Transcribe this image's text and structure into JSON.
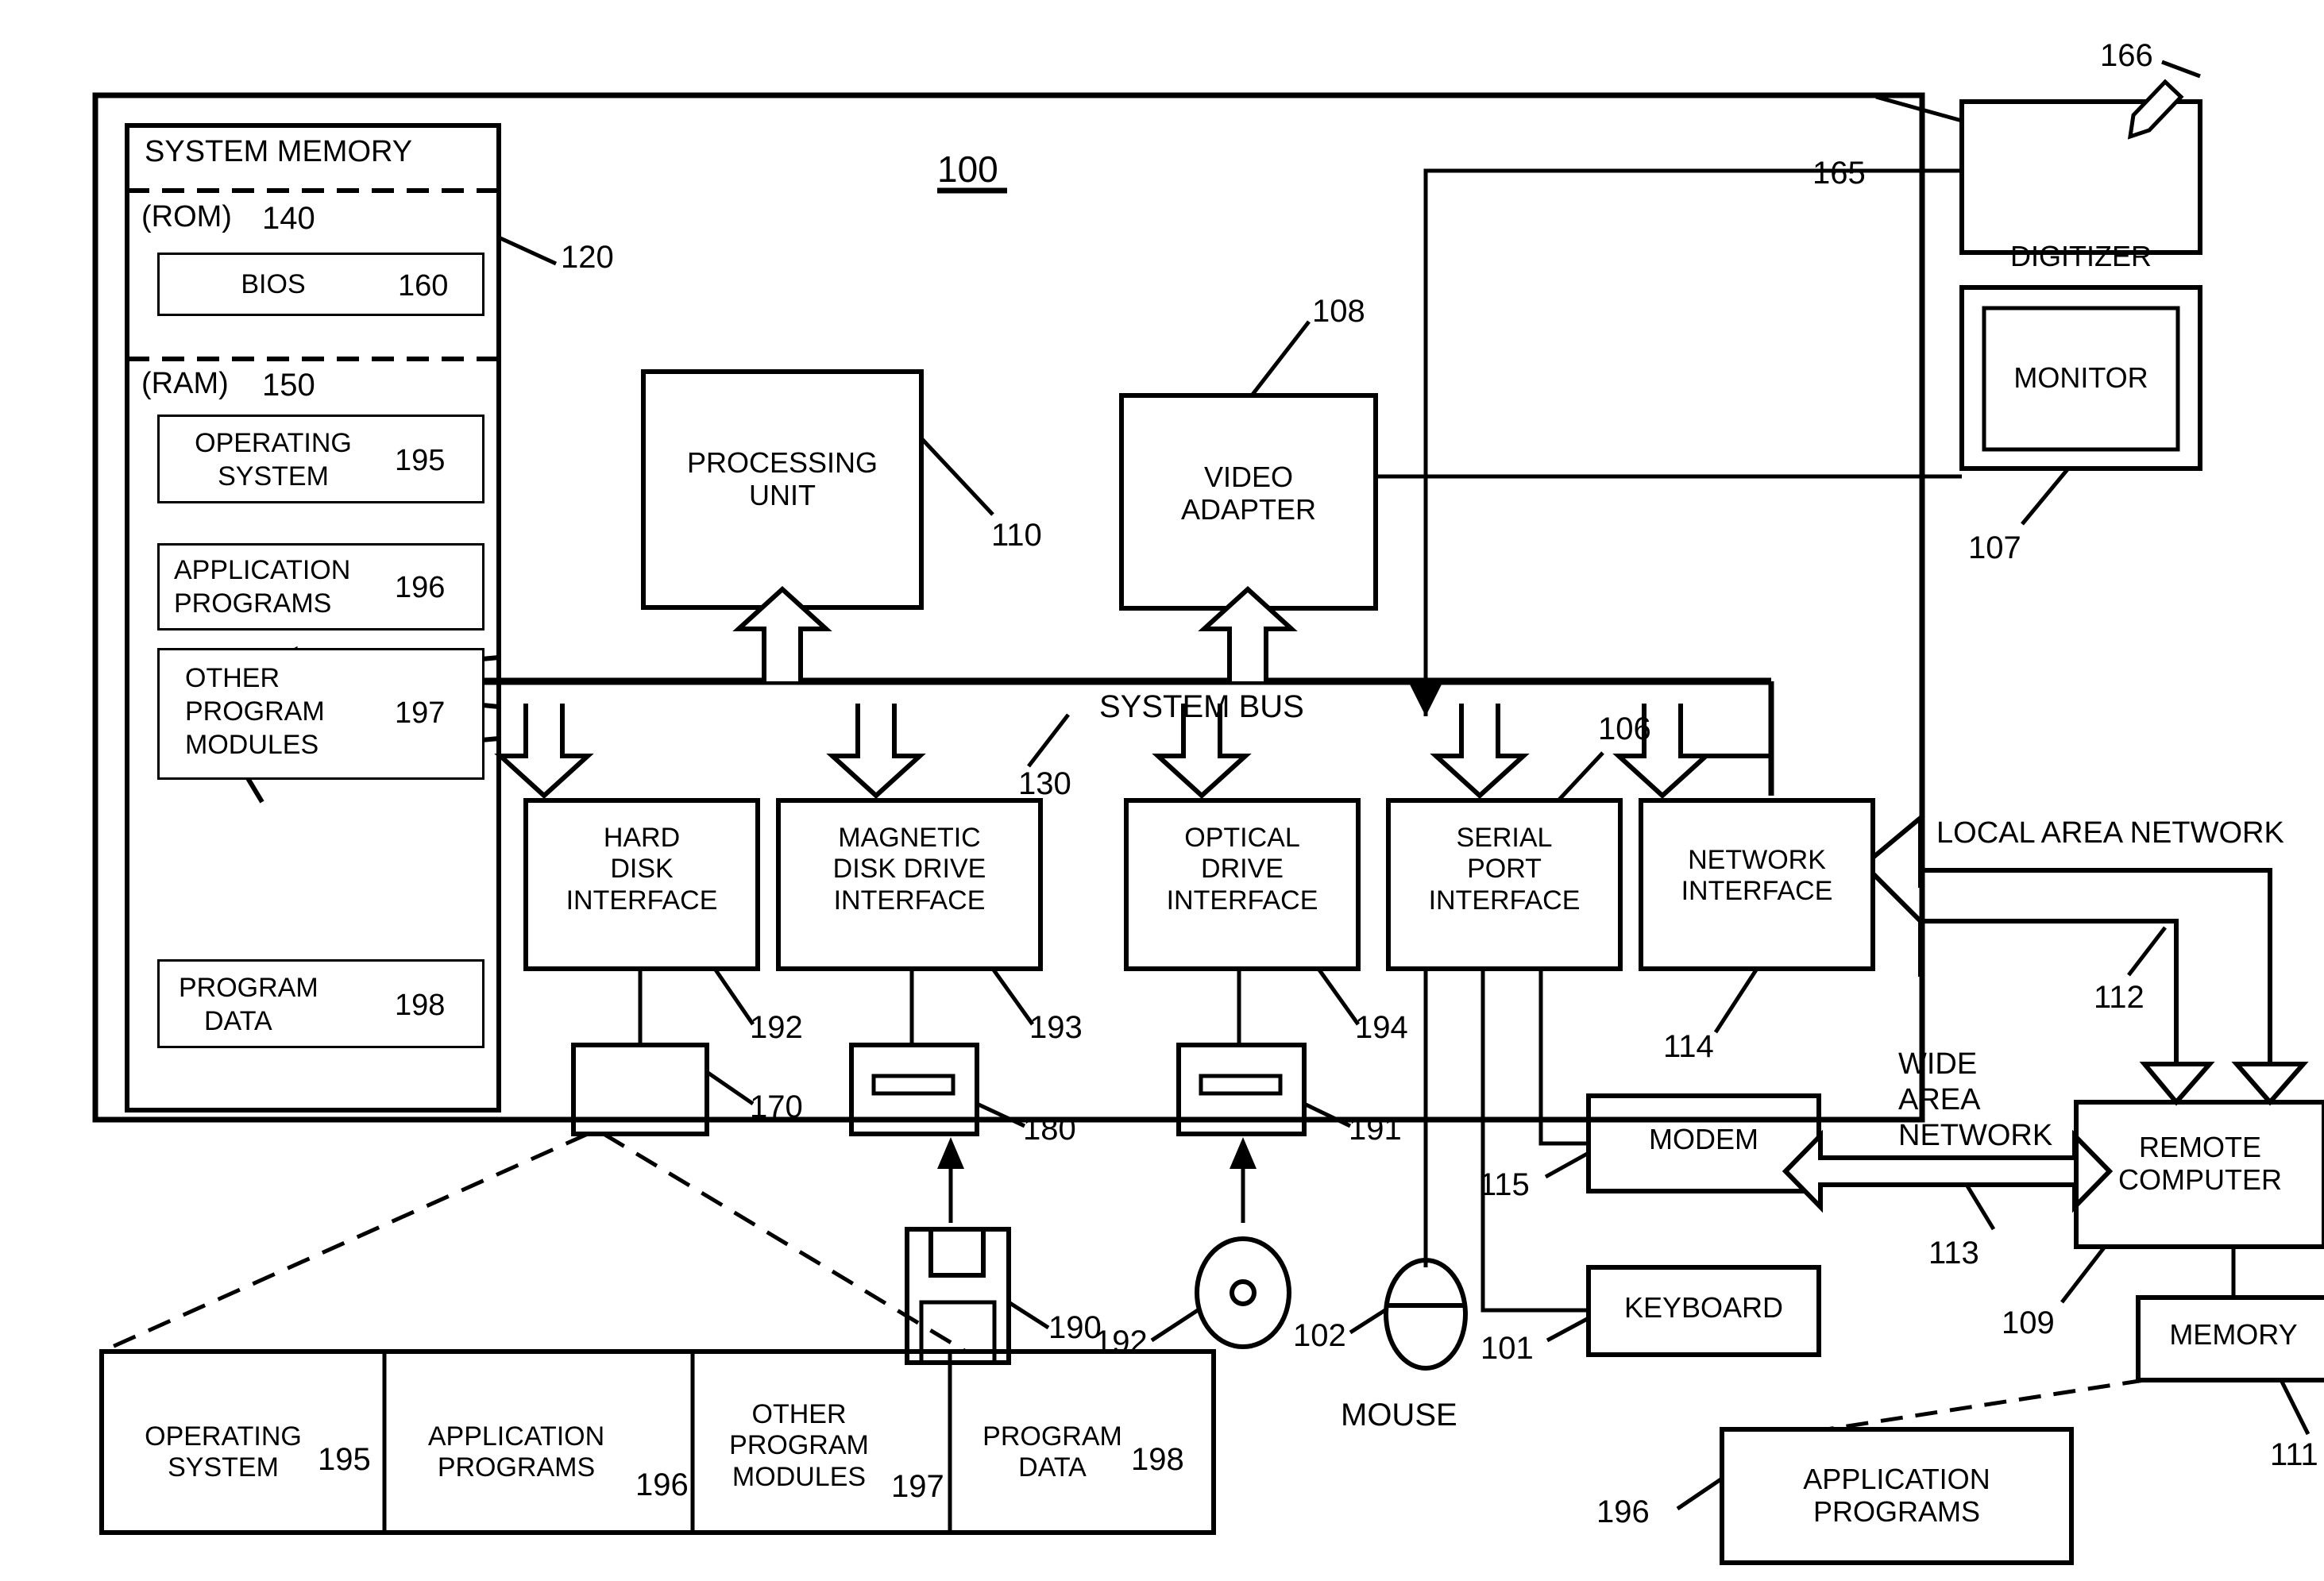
{
  "figure": {
    "main_ref": "100",
    "system_bus_label": "SYSTEM BUS",
    "system_bus_ref": "130",
    "mouse_caption": "MOUSE",
    "lan_label": "LOCAL AREA NETWORK",
    "wan_label_lines": [
      "WIDE",
      "AREA",
      "NETWORK"
    ]
  },
  "system_memory": {
    "title": "SYSTEM MEMORY",
    "ref": "120",
    "rom": {
      "label": "(ROM)",
      "ref": "140"
    },
    "ram": {
      "label": "(RAM)",
      "ref": "150"
    },
    "cells": [
      {
        "name": "bios",
        "lines": [
          "BIOS"
        ],
        "ref": "160"
      },
      {
        "name": "operating-system",
        "lines": [
          "OPERATING",
          "SYSTEM"
        ],
        "ref": "195"
      },
      {
        "name": "application-programs",
        "lines": [
          "APPLICATION",
          "PROGRAMS"
        ],
        "ref": "196"
      },
      {
        "name": "other-program-modules",
        "lines": [
          "OTHER",
          "PROGRAM",
          "MODULES"
        ],
        "ref": "197"
      },
      {
        "name": "program-data",
        "lines": [
          "PROGRAM",
          "DATA"
        ],
        "ref": "198"
      }
    ]
  },
  "core": {
    "processing_unit": {
      "lines": [
        "PROCESSING",
        "UNIT"
      ],
      "ref": "110"
    },
    "video_adapter": {
      "lines": [
        "VIDEO",
        "ADAPTER"
      ],
      "ref": "108"
    }
  },
  "interfaces": [
    {
      "name": "hard-disk-interface",
      "lines": [
        "HARD",
        "DISK",
        "INTERFACE"
      ],
      "ref": "192"
    },
    {
      "name": "magnetic-disk-drive-interface",
      "lines": [
        "MAGNETIC",
        "DISK DRIVE",
        "INTERFACE"
      ],
      "ref": "193"
    },
    {
      "name": "optical-drive-interface",
      "lines": [
        "OPTICAL",
        "DRIVE",
        "INTERFACE"
      ],
      "ref": "194"
    },
    {
      "name": "serial-port-interface",
      "lines": [
        "SERIAL",
        "PORT",
        "INTERFACE"
      ],
      "ref": "106"
    },
    {
      "name": "network-interface",
      "lines": [
        "NETWORK",
        "INTERFACE"
      ],
      "ref": "114"
    }
  ],
  "drives": [
    {
      "name": "hard-disk-drive",
      "ref": "170"
    },
    {
      "name": "magnetic-disk-drive",
      "ref": "180"
    },
    {
      "name": "optical-disk-drive",
      "ref": "191"
    }
  ],
  "media": [
    {
      "name": "floppy-disk",
      "ref": "190"
    },
    {
      "name": "optical-disc",
      "ref": "192"
    }
  ],
  "peripherals": {
    "digitizer": {
      "label": "DIGITIZER",
      "ref": "165",
      "stylus_ref": "166"
    },
    "monitor": {
      "label": "MONITOR",
      "ref": "107"
    },
    "mouse": {
      "ref": "102"
    },
    "keyboard": {
      "label": "KEYBOARD",
      "ref": "101"
    },
    "modem": {
      "label": "MODEM",
      "ref": "115"
    }
  },
  "network": {
    "remote_computer": {
      "lines": [
        "REMOTE",
        "COMPUTER"
      ],
      "ref": "109"
    },
    "memory": {
      "label": "MEMORY",
      "ref": "111"
    },
    "remote_app_programs": {
      "lines": [
        "APPLICATION",
        "PROGRAMS"
      ],
      "ref": "196"
    },
    "lan_ref": "112",
    "wan_ref": "113"
  },
  "storage_detail": [
    {
      "name": "operating-system",
      "lines": [
        "OPERATING",
        "SYSTEM"
      ],
      "ref": "195"
    },
    {
      "name": "application-programs",
      "lines": [
        "APPLICATION",
        "PROGRAMS"
      ],
      "ref": "196"
    },
    {
      "name": "other-program-modules",
      "lines": [
        "OTHER",
        "PROGRAM",
        "MODULES"
      ],
      "ref": "197"
    },
    {
      "name": "program-data",
      "lines": [
        "PROGRAM",
        "DATA"
      ],
      "ref": "198"
    }
  ]
}
